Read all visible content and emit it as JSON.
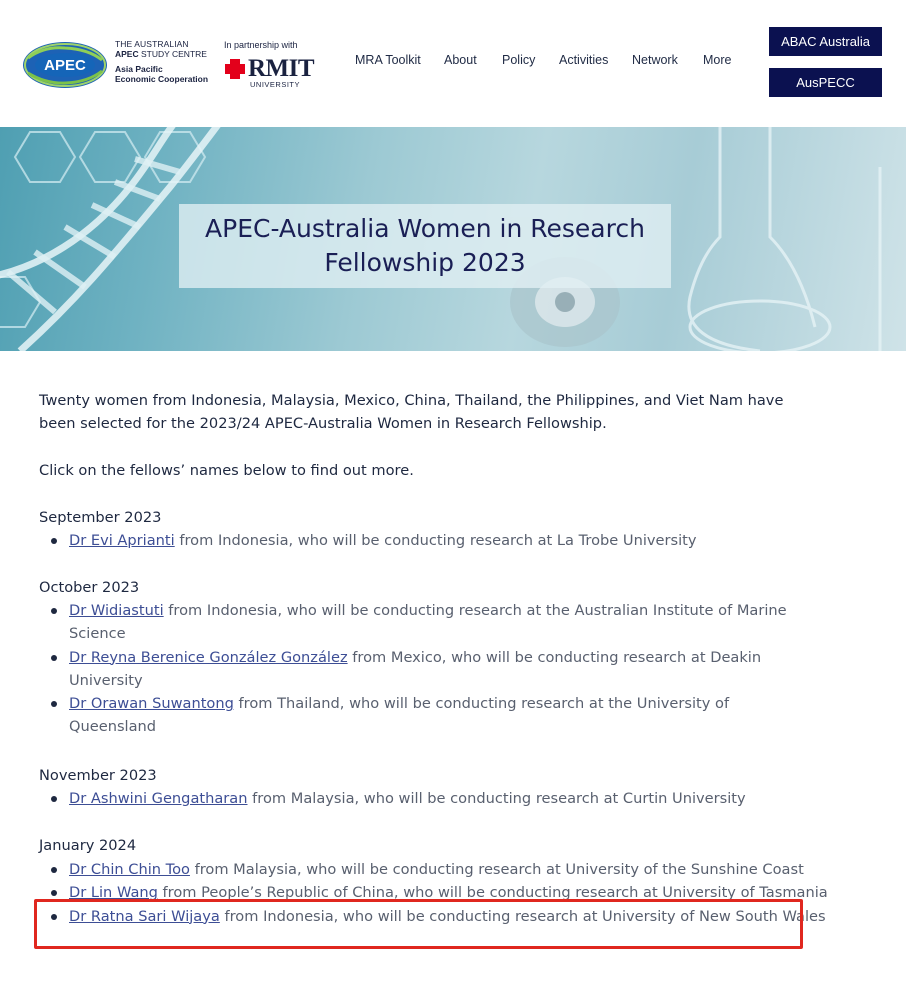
{
  "header": {
    "logo_text": "APEC",
    "org_line1": "THE AUSTRALIAN",
    "org_line2_bold": "APEC",
    "org_line2_rest": " STUDY CENTRE",
    "org_line3": "Asia Pacific",
    "org_line4": "Economic Cooperation",
    "partner_label": "In partnership with",
    "partner_name": "RMIT",
    "partner_sub": "UNIVERSITY",
    "nav": [
      "MRA Toolkit",
      "About",
      "Policy",
      "Activities",
      "Network",
      "More"
    ],
    "button_abac": "ABAC Australia",
    "button_auspecc": "AusPECC"
  },
  "hero": {
    "title_line1": "APEC-Australia Women in Research",
    "title_line2": "Fellowship 2023"
  },
  "content": {
    "intro": "Twenty women from Indonesia, Malaysia, Mexico, China, Thailand, the Philippines, and Viet Nam have been selected for the 2023/24 APEC-Australia Women in Research Fellowship.",
    "click_note": "Click on the fellows’ names below to find out more.",
    "months": [
      {
        "name": "September 2023",
        "fellows": [
          {
            "name": "Dr Evi Aprianti",
            "desc": " from Indonesia, who will be conducting research at La Trobe University"
          }
        ]
      },
      {
        "name": "October 2023",
        "fellows": [
          {
            "name": "Dr Widiastuti",
            "desc": " from Indonesia, who will be conducting research at the Australian Institute of Marine Science"
          },
          {
            "name": "Dr Reyna Berenice González González",
            "desc": " from Mexico, who will be conducting research at Deakin University"
          },
          {
            "name": "Dr Orawan Suwantong",
            "desc": " from Thailand, who will be conducting research at the University of Queensland"
          }
        ]
      },
      {
        "name": "November 2023",
        "fellows": [
          {
            "name": "Dr Ashwini Gengatharan",
            "desc": " from Malaysia, who will be conducting research at Curtin University"
          }
        ]
      },
      {
        "name": "January 2024",
        "fellows": [
          {
            "name": "Dr Chin Chin Too",
            "desc": " from Malaysia, who will be conducting research at University of the Sunshine Coast"
          },
          {
            "name": "Dr Lin Wang",
            "desc": " from People’s Republic of China, who will be conducting research at University of Tasmania"
          },
          {
            "name": "Dr Ratna Sari Wijaya",
            "desc": " from Indonesia, who will be conducting research at University of New South Wales"
          }
        ]
      }
    ]
  },
  "colors": {
    "brand_navy": "#0b1150",
    "link": "#3d4e95",
    "highlight_box": "#e0271f",
    "rmit_red": "#e3001b"
  }
}
